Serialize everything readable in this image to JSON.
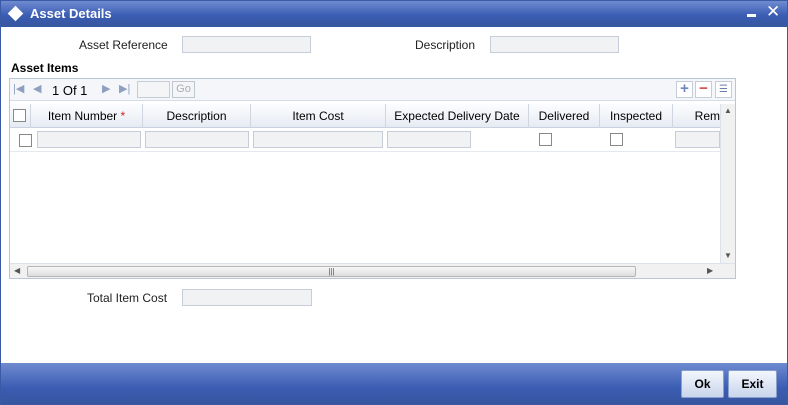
{
  "window": {
    "title": "Asset Details"
  },
  "form": {
    "asset_reference_label": "Asset Reference",
    "asset_reference_value": "",
    "description_label": "Description",
    "description_value": "",
    "total_item_cost_label": "Total Item Cost",
    "total_item_cost_value": ""
  },
  "asset_items": {
    "title": "Asset Items",
    "pager_text": "1 Of 1",
    "page_input": "",
    "go_label": "Go",
    "add_icon": "+",
    "delete_icon": "−",
    "columns": [
      {
        "label": "Item Number",
        "required": true
      },
      {
        "label": "Description"
      },
      {
        "label": "Item Cost"
      },
      {
        "label": "Expected Delivery Date"
      },
      {
        "label": "Delivered"
      },
      {
        "label": "Inspected"
      },
      {
        "label": "Rem"
      }
    ],
    "required_mark": "*",
    "rows": [
      {
        "item_number": "",
        "description": "",
        "item_cost": "",
        "expected_delivery_date": "",
        "delivered": false,
        "inspected": false,
        "remarks": ""
      }
    ]
  },
  "buttons": {
    "ok": "Ok",
    "exit": "Exit"
  },
  "icons": {
    "title": "diamond-icon",
    "minimize": "minimize-icon",
    "close": "close-icon",
    "first": "first-page-icon",
    "prev": "previous-page-icon",
    "next": "next-page-icon",
    "last": "last-page-icon",
    "add": "add-row-icon",
    "delete": "delete-row-icon",
    "single_view": "single-record-view-icon"
  },
  "colors": {
    "titlebar": "#3b5db3",
    "footer": "#3b5db3",
    "required": "#d32020"
  }
}
